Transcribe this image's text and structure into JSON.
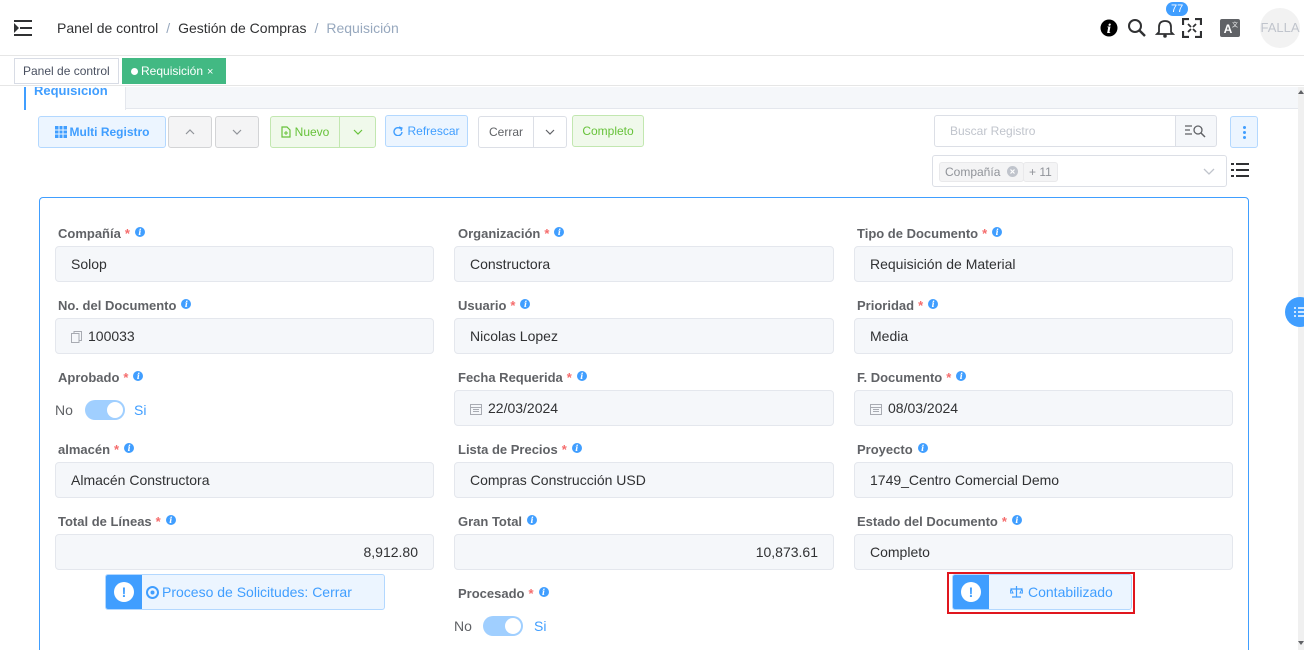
{
  "topbar": {
    "breadcrumb": [
      "Panel de control",
      "Gestión de Compras",
      "Requisición"
    ],
    "notification_count": "77",
    "avatar_text": "FALLA"
  },
  "tags": [
    {
      "label": "Panel de control",
      "active": false
    },
    {
      "label": "Requisición",
      "active": true,
      "close": "×"
    }
  ],
  "tab": {
    "label": "Requisición"
  },
  "toolbar": {
    "multi_label": "Multi Registro",
    "new_label": "Nuevo",
    "refresh_label": "Refrescar",
    "action_label": "Cerrar",
    "status_label": "Completo",
    "search_placeholder": "Buscar Registro",
    "filter_chip": "Compañía",
    "filter_more": "+ 11"
  },
  "form": {
    "switch_off": "No",
    "switch_on": "Si",
    "fields": {
      "company": {
        "label": "Compañía",
        "value": "Solop"
      },
      "organization": {
        "label": "Organización",
        "value": "Constructora"
      },
      "doc_type": {
        "label": "Tipo de Documento",
        "value": "Requisición de Material"
      },
      "doc_no": {
        "label": "No. del Documento",
        "value": "100033"
      },
      "user": {
        "label": "Usuario",
        "value": "Nicolas Lopez"
      },
      "priority": {
        "label": "Prioridad",
        "value": "Media"
      },
      "approved": {
        "label": "Aprobado",
        "value": true
      },
      "required_date": {
        "label": "Fecha Requerida",
        "value": "22/03/2024"
      },
      "doc_date": {
        "label": "F. Documento",
        "value": "08/03/2024"
      },
      "warehouse": {
        "label": "almacén",
        "value": "Almacén Constructora"
      },
      "price_list": {
        "label": "Lista de Precios",
        "value": "Compras Construcción USD"
      },
      "project": {
        "label": "Proyecto",
        "value": "1749_Centro Comercial Demo"
      },
      "lines_total": {
        "label": "Total de Líneas",
        "value": "8,912.80"
      },
      "grand_total": {
        "label": "Gran Total",
        "value": "10,873.61"
      },
      "doc_status": {
        "label": "Estado del Documento",
        "value": "Completo"
      },
      "processed": {
        "label": "Procesado",
        "value": true
      }
    },
    "process_button": "Proceso de Solicitudes: Cerrar",
    "posted_button": "Contabilizado"
  },
  "colors": {
    "primary": "#409eff",
    "success_tag": "#42b983",
    "highlight": "#e0161e"
  }
}
